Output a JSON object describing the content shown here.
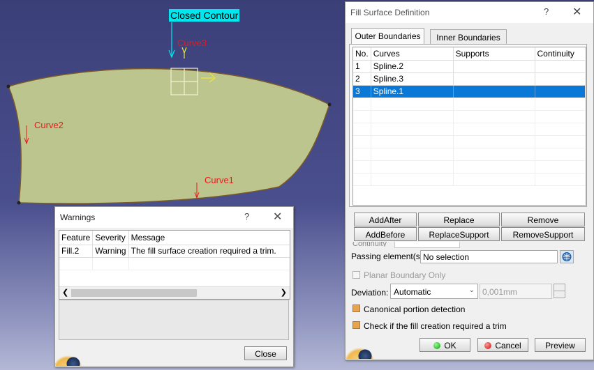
{
  "viewport": {
    "closed_contour_label": "Closed Contour",
    "curve_labels": [
      "Curve3",
      "Curve2",
      "Curve1"
    ]
  },
  "fill_dialog": {
    "title": "Fill Surface Definition",
    "help": "?",
    "close": "✕",
    "tabs": [
      "Outer Boundaries",
      "Inner Boundaries"
    ],
    "columns": [
      "No.",
      "Curves",
      "Supports",
      "Continuity"
    ],
    "rows": [
      {
        "no": "1",
        "curve": "Spline.2",
        "support": "",
        "continuity": ""
      },
      {
        "no": "2",
        "curve": "Spline.3",
        "support": "",
        "continuity": ""
      },
      {
        "no": "3",
        "curve": "Spline.1",
        "support": "",
        "continuity": "",
        "selected": true
      }
    ],
    "buttons_row1": [
      "AddAfter",
      "Replace",
      "Remove"
    ],
    "buttons_row2": [
      "AddBefore",
      "ReplaceSupport",
      "RemoveSupport"
    ],
    "hidden_label_fragment": "Continuity",
    "passing_label": "Passing element(s):",
    "passing_value": "No selection",
    "planar_label": "Planar Boundary Only",
    "deviation_label": "Deviation:",
    "deviation_mode": "Automatic",
    "deviation_value": "0,001mm",
    "canonical_label": "Canonical portion detection",
    "trim_check_label": "Check if the fill creation required a trim",
    "ok": "OK",
    "cancel": "Cancel",
    "preview": "Preview"
  },
  "warnings_dialog": {
    "title": "Warnings",
    "help": "?",
    "close_x": "✕",
    "columns": [
      "Feature",
      "Severity",
      "Message"
    ],
    "rows": [
      {
        "feature": "Fill.2",
        "severity": "Warning",
        "message": "The fill surface creation required a trim."
      }
    ],
    "close_button": "Close"
  },
  "colors": {
    "surface": "#bcc58d",
    "selection": "#0a78d7",
    "curve_label": "#e81a1a",
    "contour_label_bg": "#00e8ef"
  }
}
